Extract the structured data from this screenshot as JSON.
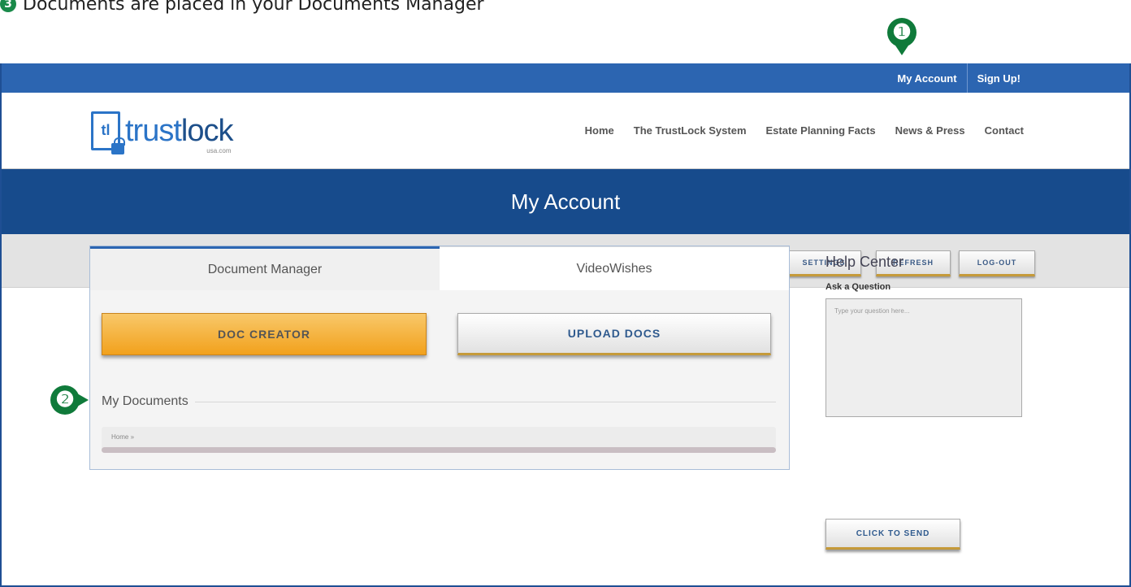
{
  "caption": {
    "marker": "3",
    "text": "Documents are placed in your Documents Manager"
  },
  "callouts": [
    "❶",
    "❷"
  ],
  "topbar": {
    "my_account": "My Account",
    "sign_up": "Sign Up!"
  },
  "logo": {
    "box_text": "tl",
    "text_main": "trust",
    "text_accent": "lock",
    "sub": "usa.com"
  },
  "nav": [
    "Home",
    "The TrustLock System",
    "Estate Planning Facts",
    "News & Press",
    "Contact"
  ],
  "banner": {
    "title": "My Account"
  },
  "toolbar": {
    "settings": "SETTINGS",
    "refresh": "REFRESH",
    "logout": "LOG-OUT"
  },
  "tabs": [
    "Document Manager",
    "VideoWishes"
  ],
  "actions": {
    "doc_creator": "DOC CREATOR",
    "upload_docs": "UPLOAD DOCS"
  },
  "documents": {
    "title": "My Documents",
    "breadcrumb": "Home »"
  },
  "help": {
    "title": "Help Center",
    "subtitle": "Ask a Question",
    "placeholder": "Type your question here...",
    "send": "CLICK TO SEND"
  },
  "colors": {
    "accent_blue": "#2c65b1",
    "banner_blue": "#174b8c",
    "orange": "#f2a11c",
    "callout_green": "#0f7a3a"
  }
}
